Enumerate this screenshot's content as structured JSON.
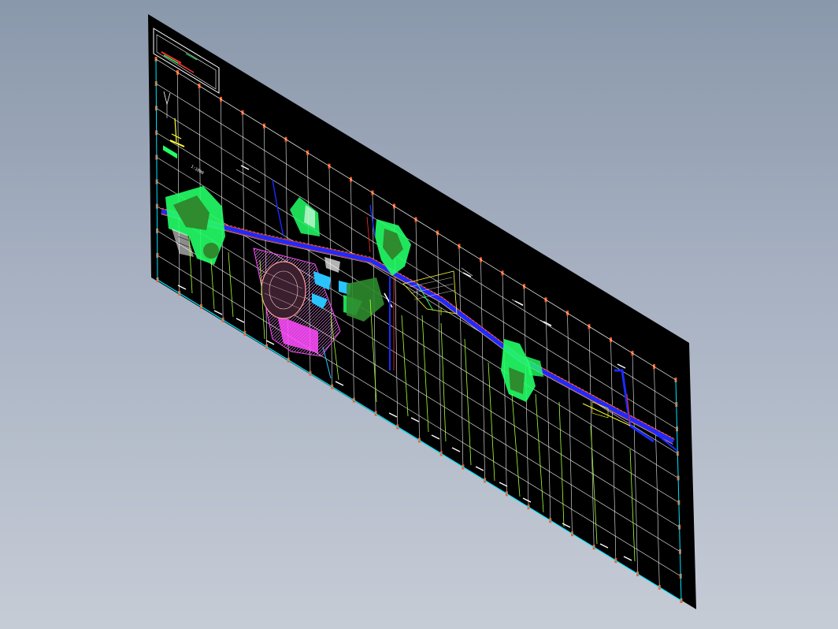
{
  "viewport": {
    "background_top": "#8a98ab",
    "background_bottom": "#c6ccd6",
    "view_mode": "isometric"
  },
  "drawing": {
    "sheet_color": "#000000",
    "grid_color": "#f0f0f0",
    "border_accent": "#00e5ff",
    "tick_color": "#ff5a1f",
    "scale_note": "1:1000",
    "colors": {
      "road": "#1a2cff",
      "road_edge": "#ff2a2a",
      "green_area": "#22ff66",
      "vegetation": "#2e8b2e",
      "plaza": "#ff4cff",
      "water": "#29c4ff",
      "survey_line": "#a8ff3a",
      "annotation": "#ffff33"
    }
  }
}
